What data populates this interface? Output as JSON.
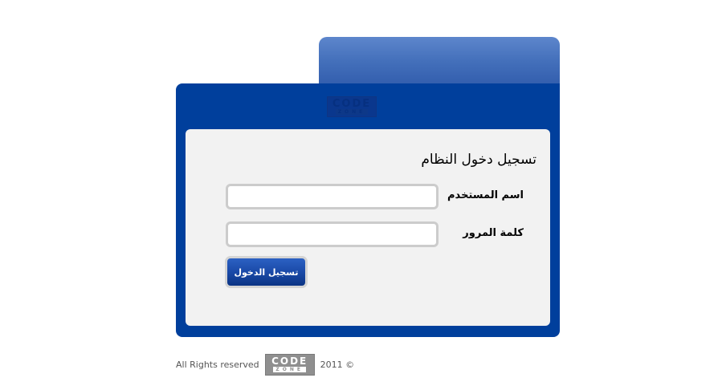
{
  "logo": {
    "top_text": "CODE",
    "bottom_text": "ZONE"
  },
  "form": {
    "title": "تسجيل دخول النظام",
    "username_label": "اسم المستخدم",
    "username_value": "",
    "password_label": "كلمة المرور",
    "password_value": "",
    "login_button": "تسجيل الدخول"
  },
  "footer": {
    "rights": "All Rights reserved",
    "year": "2011 ©"
  },
  "colors": {
    "panel": "#003f9c",
    "tab": "#4470bb",
    "card": "#f2f2f2",
    "button": "#1a4aa8"
  }
}
